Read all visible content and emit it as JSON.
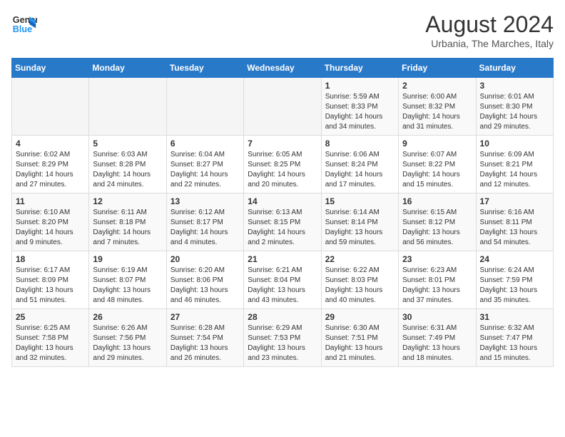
{
  "header": {
    "logo_line1": "General",
    "logo_line2": "Blue",
    "month_year": "August 2024",
    "location": "Urbania, The Marches, Italy"
  },
  "weekdays": [
    "Sunday",
    "Monday",
    "Tuesday",
    "Wednesday",
    "Thursday",
    "Friday",
    "Saturday"
  ],
  "weeks": [
    [
      {
        "day": "",
        "info": ""
      },
      {
        "day": "",
        "info": ""
      },
      {
        "day": "",
        "info": ""
      },
      {
        "day": "",
        "info": ""
      },
      {
        "day": "1",
        "info": "Sunrise: 5:59 AM\nSunset: 8:33 PM\nDaylight: 14 hours\nand 34 minutes."
      },
      {
        "day": "2",
        "info": "Sunrise: 6:00 AM\nSunset: 8:32 PM\nDaylight: 14 hours\nand 31 minutes."
      },
      {
        "day": "3",
        "info": "Sunrise: 6:01 AM\nSunset: 8:30 PM\nDaylight: 14 hours\nand 29 minutes."
      }
    ],
    [
      {
        "day": "4",
        "info": "Sunrise: 6:02 AM\nSunset: 8:29 PM\nDaylight: 14 hours\nand 27 minutes."
      },
      {
        "day": "5",
        "info": "Sunrise: 6:03 AM\nSunset: 8:28 PM\nDaylight: 14 hours\nand 24 minutes."
      },
      {
        "day": "6",
        "info": "Sunrise: 6:04 AM\nSunset: 8:27 PM\nDaylight: 14 hours\nand 22 minutes."
      },
      {
        "day": "7",
        "info": "Sunrise: 6:05 AM\nSunset: 8:25 PM\nDaylight: 14 hours\nand 20 minutes."
      },
      {
        "day": "8",
        "info": "Sunrise: 6:06 AM\nSunset: 8:24 PM\nDaylight: 14 hours\nand 17 minutes."
      },
      {
        "day": "9",
        "info": "Sunrise: 6:07 AM\nSunset: 8:22 PM\nDaylight: 14 hours\nand 15 minutes."
      },
      {
        "day": "10",
        "info": "Sunrise: 6:09 AM\nSunset: 8:21 PM\nDaylight: 14 hours\nand 12 minutes."
      }
    ],
    [
      {
        "day": "11",
        "info": "Sunrise: 6:10 AM\nSunset: 8:20 PM\nDaylight: 14 hours\nand 9 minutes."
      },
      {
        "day": "12",
        "info": "Sunrise: 6:11 AM\nSunset: 8:18 PM\nDaylight: 14 hours\nand 7 minutes."
      },
      {
        "day": "13",
        "info": "Sunrise: 6:12 AM\nSunset: 8:17 PM\nDaylight: 14 hours\nand 4 minutes."
      },
      {
        "day": "14",
        "info": "Sunrise: 6:13 AM\nSunset: 8:15 PM\nDaylight: 14 hours\nand 2 minutes."
      },
      {
        "day": "15",
        "info": "Sunrise: 6:14 AM\nSunset: 8:14 PM\nDaylight: 13 hours\nand 59 minutes."
      },
      {
        "day": "16",
        "info": "Sunrise: 6:15 AM\nSunset: 8:12 PM\nDaylight: 13 hours\nand 56 minutes."
      },
      {
        "day": "17",
        "info": "Sunrise: 6:16 AM\nSunset: 8:11 PM\nDaylight: 13 hours\nand 54 minutes."
      }
    ],
    [
      {
        "day": "18",
        "info": "Sunrise: 6:17 AM\nSunset: 8:09 PM\nDaylight: 13 hours\nand 51 minutes."
      },
      {
        "day": "19",
        "info": "Sunrise: 6:19 AM\nSunset: 8:07 PM\nDaylight: 13 hours\nand 48 minutes."
      },
      {
        "day": "20",
        "info": "Sunrise: 6:20 AM\nSunset: 8:06 PM\nDaylight: 13 hours\nand 46 minutes."
      },
      {
        "day": "21",
        "info": "Sunrise: 6:21 AM\nSunset: 8:04 PM\nDaylight: 13 hours\nand 43 minutes."
      },
      {
        "day": "22",
        "info": "Sunrise: 6:22 AM\nSunset: 8:03 PM\nDaylight: 13 hours\nand 40 minutes."
      },
      {
        "day": "23",
        "info": "Sunrise: 6:23 AM\nSunset: 8:01 PM\nDaylight: 13 hours\nand 37 minutes."
      },
      {
        "day": "24",
        "info": "Sunrise: 6:24 AM\nSunset: 7:59 PM\nDaylight: 13 hours\nand 35 minutes."
      }
    ],
    [
      {
        "day": "25",
        "info": "Sunrise: 6:25 AM\nSunset: 7:58 PM\nDaylight: 13 hours\nand 32 minutes."
      },
      {
        "day": "26",
        "info": "Sunrise: 6:26 AM\nSunset: 7:56 PM\nDaylight: 13 hours\nand 29 minutes."
      },
      {
        "day": "27",
        "info": "Sunrise: 6:28 AM\nSunset: 7:54 PM\nDaylight: 13 hours\nand 26 minutes."
      },
      {
        "day": "28",
        "info": "Sunrise: 6:29 AM\nSunset: 7:53 PM\nDaylight: 13 hours\nand 23 minutes."
      },
      {
        "day": "29",
        "info": "Sunrise: 6:30 AM\nSunset: 7:51 PM\nDaylight: 13 hours\nand 21 minutes."
      },
      {
        "day": "30",
        "info": "Sunrise: 6:31 AM\nSunset: 7:49 PM\nDaylight: 13 hours\nand 18 minutes."
      },
      {
        "day": "31",
        "info": "Sunrise: 6:32 AM\nSunset: 7:47 PM\nDaylight: 13 hours\nand 15 minutes."
      }
    ]
  ]
}
